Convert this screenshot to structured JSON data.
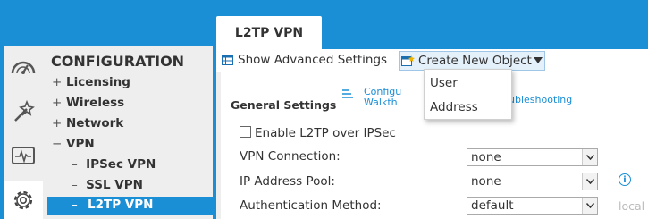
{
  "header": {
    "tab_label": "L2TP VPN"
  },
  "sidebar": {
    "title": "CONFIGURATION",
    "items": [
      {
        "sign": "+",
        "label": "Licensing"
      },
      {
        "sign": "+",
        "label": "Wireless"
      },
      {
        "sign": "+",
        "label": "Network"
      },
      {
        "sign": "−",
        "label": "VPN"
      }
    ],
    "subitems": [
      {
        "label": "IPSec VPN"
      },
      {
        "label": "SSL VPN"
      },
      {
        "label": "L2TP VPN",
        "selected": true
      }
    ],
    "rail_icons": [
      "dashboard-icon",
      "magic-wand-icon",
      "monitor-icon",
      "gear-icon"
    ]
  },
  "toolbar": {
    "show_advanced_label": "Show Advanced Settings",
    "create_new_object_label": "Create New Object"
  },
  "dropdown": {
    "items": [
      "User",
      "Address"
    ]
  },
  "general": {
    "title": "General Settings",
    "link1_line1": "Configu",
    "link1_line2": "Walkth",
    "link2": "ubleshooting"
  },
  "form": {
    "enable_label": "Enable L2TP over IPSec",
    "enable_checked": false,
    "vpn_connection_label": "VPN Connection:",
    "vpn_connection_value": "none",
    "ip_pool_label": "IP Address Pool:",
    "ip_pool_value": "none",
    "auth_label": "Authentication Method:",
    "auth_value": "default",
    "auth_hint": "local"
  },
  "colors": {
    "accent": "#1a8fd6",
    "panel": "#eeeeee"
  }
}
